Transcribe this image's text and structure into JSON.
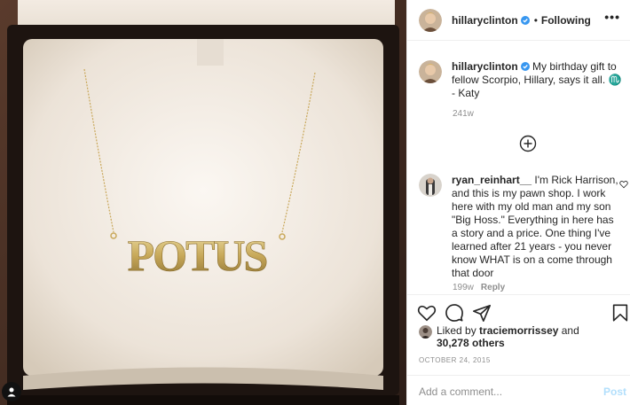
{
  "post": {
    "username": "hillaryclinton",
    "follow_status": "Following",
    "dot": "•",
    "more_icon": "•••",
    "image_text": "POTUS",
    "caption": {
      "username": "hillaryclinton",
      "text": " My birthday gift to fellow Scorpio, Hillary, says it all. ♏ - Katy",
      "age": "241w"
    },
    "comments": [
      {
        "username": "ryan_reinhart__",
        "text": " I'm Rick Harrison, and this is my pawn shop. I work here with my old man and my son \"Big Hoss.\" Everything in here has a story and a price. One thing I've learned after 21 years - you never know WHAT is on a come through that door",
        "age": "199w",
        "reply_label": "Reply"
      }
    ],
    "likes": {
      "prefix": "Liked by ",
      "liker": "traciemorrissey",
      "and": " and",
      "others": "30,278 others"
    },
    "date": "OCTOBER 24, 2015",
    "comment_box": {
      "placeholder": "Add a comment...",
      "post_label": "Post"
    }
  },
  "colors": {
    "verified_blue": "#3897f0",
    "muted_text": "#8e8e8e",
    "post_disabled": "#b2dffc",
    "zodiac_purple": "#9b3fc8"
  }
}
